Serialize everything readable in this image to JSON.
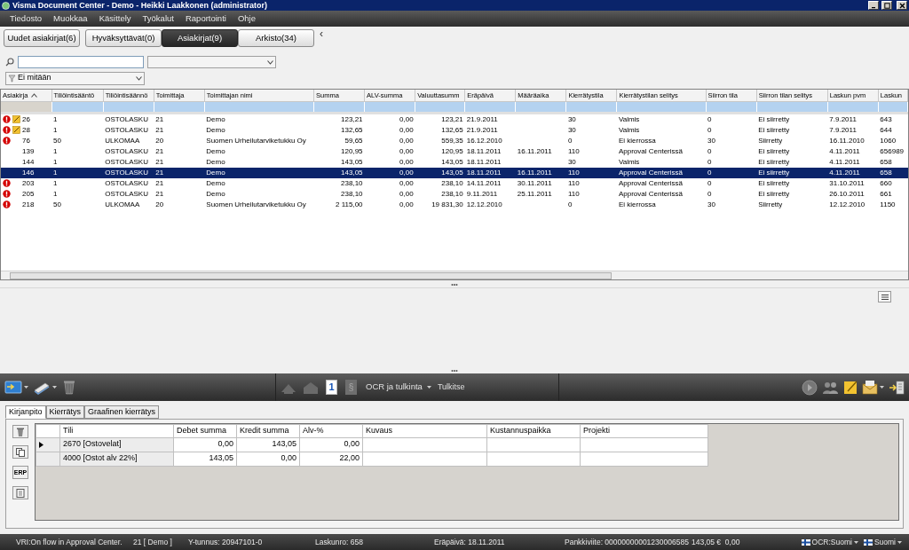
{
  "window": {
    "title": "Visma Document Center - Demo - Heikki Laakkonen (administrator)"
  },
  "menu": [
    "Tiedosto",
    "Muokkaa",
    "Käsittely",
    "Työkalut",
    "Raportointi",
    "Ohje"
  ],
  "tabs": [
    {
      "label": "Uudet asiakirjat(6)",
      "selected": false
    },
    {
      "label": "Hyväksyttävät(0)",
      "selected": false
    },
    {
      "label": "Asiakirjat(9)",
      "selected": true
    },
    {
      "label": "Arkisto(34)",
      "selected": false
    }
  ],
  "collapse_glyph": "‹",
  "filter": {
    "value": "Ei mitään"
  },
  "grid": {
    "columns": [
      "Asiakirja",
      "Tiliöintisääntö",
      "Tiliöintisäännö",
      "Toimittaja",
      "Toimittajan nimi",
      "Summa",
      "ALV-summa",
      "Valuuttasumm",
      "Eräpäivä",
      "Määräaika",
      "Kierrätystila",
      "Kierrätystilan selitys",
      "Siirron tila",
      "Siirron tilan selitys",
      "Laskun pvm",
      "Laskun"
    ],
    "rows": [
      {
        "warning": true,
        "note": true,
        "selected": false,
        "cells": [
          "26",
          "1",
          "OSTOLASKU",
          "21",
          "Demo",
          "123,21",
          "0,00",
          "123,21",
          "21.9.2011",
          "",
          "30",
          "Valmis",
          "0",
          "Ei siirretty",
          "7.9.2011",
          "643"
        ]
      },
      {
        "warning": true,
        "note": true,
        "selected": false,
        "cells": [
          "28",
          "1",
          "OSTOLASKU",
          "21",
          "Demo",
          "132,65",
          "0,00",
          "132,65",
          "21.9.2011",
          "",
          "30",
          "Valmis",
          "0",
          "Ei siirretty",
          "7.9.2011",
          "644"
        ]
      },
      {
        "warning": true,
        "note": false,
        "selected": false,
        "cells": [
          "76",
          "50",
          "ULKOMAA",
          "20",
          "Suomen Urheilutarviketukku Oy",
          "59,65",
          "0,00",
          "559,35",
          "16.12.2010",
          "",
          "0",
          "Ei kierrossa",
          "30",
          "Siirretty",
          "16.11.2010",
          "1060"
        ]
      },
      {
        "warning": false,
        "note": false,
        "selected": false,
        "cells": [
          "139",
          "1",
          "OSTOLASKU",
          "21",
          "Demo",
          "120,95",
          "0,00",
          "120,95",
          "18.11.2011",
          "16.11.2011",
          "110",
          "Approval Centerissä",
          "0",
          "Ei siirretty",
          "4.11.2011",
          "656989"
        ]
      },
      {
        "warning": false,
        "note": false,
        "selected": false,
        "cells": [
          "144",
          "1",
          "OSTOLASKU",
          "21",
          "Demo",
          "143,05",
          "0,00",
          "143,05",
          "18.11.2011",
          "",
          "30",
          "Valmis",
          "0",
          "Ei siirretty",
          "4.11.2011",
          "658"
        ]
      },
      {
        "warning": false,
        "note": false,
        "selected": true,
        "cells": [
          "146",
          "1",
          "OSTOLASKU",
          "21",
          "Demo",
          "143,05",
          "0,00",
          "143,05",
          "18.11.2011",
          "16.11.2011",
          "110",
          "Approval Centerissä",
          "0",
          "Ei siirretty",
          "4.11.2011",
          "658"
        ]
      },
      {
        "warning": true,
        "note": false,
        "selected": false,
        "cells": [
          "203",
          "1",
          "OSTOLASKU",
          "21",
          "Demo",
          "238,10",
          "0,00",
          "238,10",
          "14.11.2011",
          "30.11.2011",
          "110",
          "Approval Centerissä",
          "0",
          "Ei siirretty",
          "31.10.2011",
          "660"
        ]
      },
      {
        "warning": true,
        "note": false,
        "selected": false,
        "cells": [
          "205",
          "1",
          "OSTOLASKU",
          "21",
          "Demo",
          "238,10",
          "0,00",
          "238,10",
          "9.11.2011",
          "25.11.2011",
          "110",
          "Approval Centerissä",
          "0",
          "Ei siirretty",
          "26.10.2011",
          "661"
        ]
      },
      {
        "warning": true,
        "note": false,
        "selected": false,
        "cells": [
          "218",
          "50",
          "ULKOMAA",
          "20",
          "Suomen Urheilutarviketukku Oy",
          "2 115,00",
          "0,00",
          "19 831,30",
          "12.12.2010",
          "",
          "0",
          "Ei kierrossa",
          "30",
          "Siirretty",
          "12.12.2010",
          "1150"
        ]
      }
    ]
  },
  "splitter_glyph": "•••",
  "toolbar": {
    "page_glyph": "1",
    "section_glyph": "§",
    "ocr_menu": "OCR ja tulkinta",
    "interpret": "Tulkitse"
  },
  "detail_tabs": [
    {
      "label": "Kirjanpito",
      "selected": true
    },
    {
      "label": "Kierrätys",
      "selected": false
    },
    {
      "label": "Graafinen kierrätys",
      "selected": false
    }
  ],
  "side_tools": {
    "erp": "ERP"
  },
  "entries": {
    "columns": [
      "Tili",
      "Debet summa",
      "Kredit summa",
      "Alv-%",
      "Kuvaus",
      "Kustannuspaikka",
      "Projekti"
    ],
    "rows": [
      {
        "current": true,
        "cells": [
          "2670 [Ostovelat]",
          "0,00",
          "143,05",
          "0,00",
          "",
          "",
          ""
        ]
      },
      {
        "current": false,
        "cells": [
          "4000 [Ostot alv 22%]",
          "143,05",
          "0,00",
          "22,00",
          "",
          "",
          ""
        ]
      }
    ]
  },
  "status_bar": {
    "items": [
      "VRI:On flow in Approval Center.",
      "21 [ Demo ]",
      "Y-tunnus: 20947101-0",
      "Laskunro: 658",
      "Eräpäivä: 18.11.2011",
      "Pankkiviite: 00000000001230006585",
      "143,05 €  0,00"
    ],
    "ocr_language": "OCR:Suomi",
    "language": "Suomi"
  }
}
